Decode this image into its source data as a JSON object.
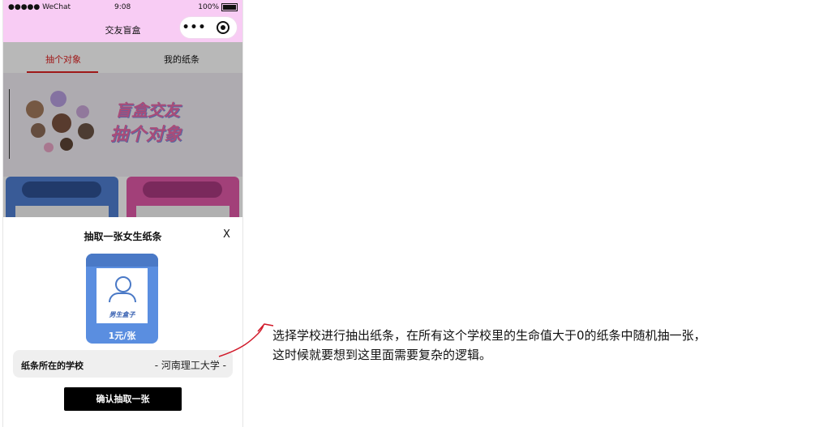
{
  "status_bar": {
    "carrier": "●●●●● WeChat",
    "time": "9:08",
    "battery": "100%"
  },
  "nav": {
    "title": "交友盲盒",
    "more_icon": "more-dots-icon",
    "capsule_icon": "target-icon"
  },
  "tabs": [
    {
      "label": "抽个对象",
      "active": true
    },
    {
      "label": "我的纸条",
      "active": false
    }
  ],
  "banner": {
    "line1": "盲盒交友",
    "line2": "抽个对象"
  },
  "sheet": {
    "title": "抽取一张女生纸条",
    "close_label": "X",
    "box_caption": "男生盒子",
    "box_price": "1元/张",
    "school_label": "纸条所在的学校",
    "school_value": "- 河南理工大学 -",
    "confirm_label": "确认抽取一张"
  },
  "annotation": {
    "line1": "选择学校进行抽出纸条，在所有这个学校里的生命值大于0的纸条中随机抽一张，",
    "line2": "这时候就要想到这里面需要复杂的逻辑。",
    "color": "#d11a2a"
  },
  "colors": {
    "nav_bg": "#f8ccf4",
    "active_tab": "#dd2222",
    "box_blue": "#5a8ee0",
    "card_pink": "#e159a8"
  }
}
